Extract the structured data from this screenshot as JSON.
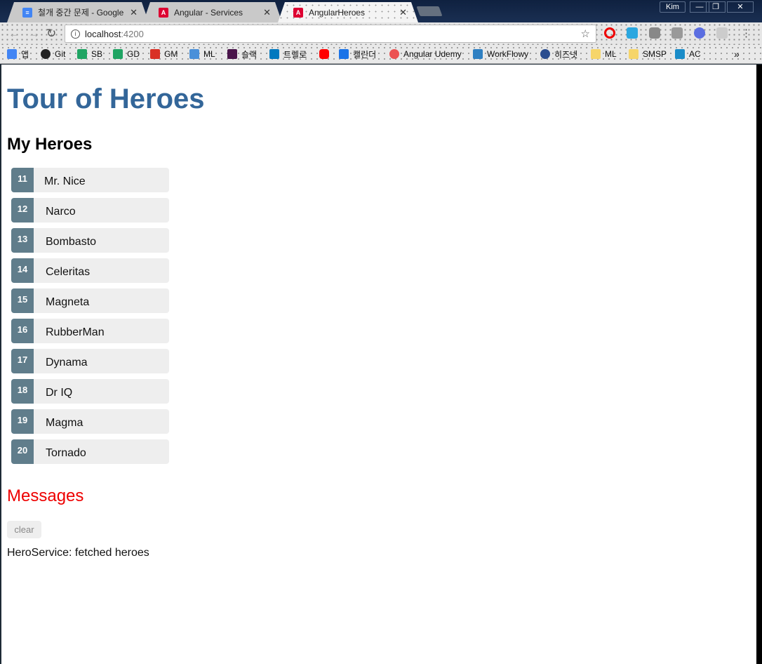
{
  "browser": {
    "tabs": [
      {
        "title": "철개 중간 문제 - Google",
        "icon": "google-docs-icon",
        "color": "#4285f4"
      },
      {
        "title": "Angular - Services",
        "icon": "angular-icon",
        "color": "#dd0031"
      },
      {
        "title": "AngularHeroes",
        "icon": "angular-icon",
        "color": "#dd0031"
      }
    ],
    "tab_close": "✕",
    "user": "Kim",
    "window_controls": {
      "minimize": "—",
      "restore": "❐",
      "close": "✕"
    },
    "address": {
      "host": "localhost",
      "port": ":4200"
    },
    "bookmarks": [
      {
        "label": "앱",
        "icon": "apps-icon",
        "color": "#4285f4"
      },
      {
        "label": "Git",
        "icon": "github-icon",
        "color": "#222222"
      },
      {
        "label": "SB",
        "icon": "google-drive-icon",
        "color": "#1fa463"
      },
      {
        "label": "GD",
        "icon": "google-drive-icon",
        "color": "#1fa463"
      },
      {
        "label": "GM",
        "icon": "gmail-icon",
        "color": "#d93025"
      },
      {
        "label": "ML",
        "icon": "ml-icon",
        "color": "#4a90d9"
      },
      {
        "label": "슬랙",
        "icon": "slack-icon",
        "color": "#4a154b"
      },
      {
        "label": "트렐로",
        "icon": "trello-icon",
        "color": "#0079bf"
      },
      {
        "label": "",
        "icon": "youtube-icon",
        "color": "#ff0000"
      },
      {
        "label": "캘린더",
        "icon": "calendar-icon",
        "color": "#1a73e8"
      },
      {
        "label": "Angular Udemy",
        "icon": "udemy-icon",
        "color": "#ec5252"
      },
      {
        "label": "WorkFlowy",
        "icon": "workflowy-icon",
        "color": "#2f80c2"
      },
      {
        "label": "히즈넷",
        "icon": "globe-icon",
        "color": "#2a4d8f"
      },
      {
        "label": "ML",
        "icon": "folder-icon",
        "color": "#f6d56a"
      },
      {
        "label": "SMSP",
        "icon": "folder-icon",
        "color": "#f6d56a"
      },
      {
        "label": "AC",
        "icon": "capture-icon",
        "color": "#1a8cc8"
      }
    ],
    "bookmarks_overflow": "»"
  },
  "app": {
    "title": "Tour of Heroes",
    "heroes_heading": "My Heroes",
    "heroes": [
      {
        "id": "11",
        "name": "Mr. Nice"
      },
      {
        "id": "12",
        "name": "Narco"
      },
      {
        "id": "13",
        "name": "Bombasto"
      },
      {
        "id": "14",
        "name": "Celeritas"
      },
      {
        "id": "15",
        "name": "Magneta"
      },
      {
        "id": "16",
        "name": "RubberMan"
      },
      {
        "id": "17",
        "name": "Dynama"
      },
      {
        "id": "18",
        "name": "Dr IQ"
      },
      {
        "id": "19",
        "name": "Magma"
      },
      {
        "id": "20",
        "name": "Tornado"
      }
    ],
    "messages_heading": "Messages",
    "clear_label": "clear",
    "messages": [
      "HeroService: fetched heroes"
    ]
  }
}
